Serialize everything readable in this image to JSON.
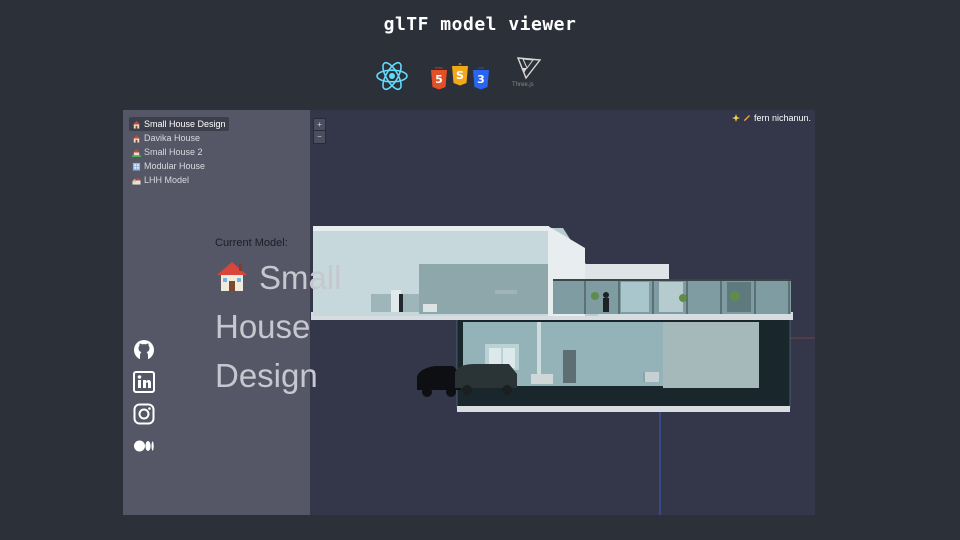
{
  "page": {
    "title": "glTF model viewer"
  },
  "tech_icons": [
    "react-icon",
    "html5-icon",
    "css3-icon",
    "threejs-icon"
  ],
  "tech_label": "Three.js",
  "models": [
    {
      "label": "Small House Design",
      "active": true
    },
    {
      "label": "Davika House",
      "active": false
    },
    {
      "label": "Small House 2",
      "active": false
    },
    {
      "label": "Modular House",
      "active": false
    },
    {
      "label": "LHH Model",
      "active": false
    }
  ],
  "current": {
    "label": "Current Model:",
    "name": "Small House Design"
  },
  "social": [
    "github-icon",
    "linkedin-icon",
    "instagram-icon",
    "medium-icon"
  ],
  "zoom": {
    "in": "+",
    "out": "−"
  },
  "credit": {
    "name": "fern nichanun."
  },
  "colors": {
    "background": "#2c3038",
    "viewer": "#34364a",
    "sidebar": "#555666"
  }
}
